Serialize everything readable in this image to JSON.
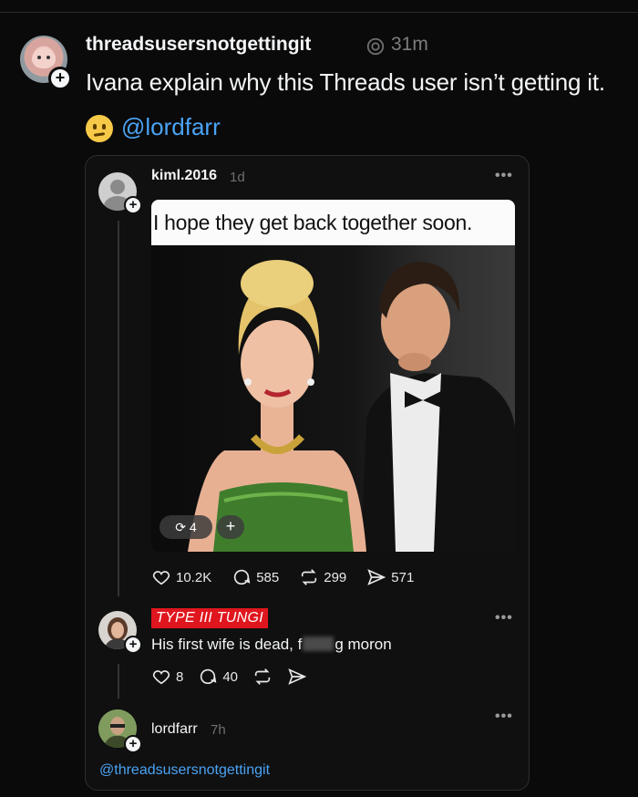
{
  "post": {
    "username": "threadsusersnotgettingit",
    "time": "31m",
    "text": "Ivana explain why this Threads user isn’t getting it.",
    "mention": "@lordfarr",
    "emoji_icon": "slightly-smiling-face-icon"
  },
  "quoted": {
    "username": "kiml.2016",
    "time": "1d",
    "meme_caption": "I hope they get back together soon.",
    "repost_chip": "4",
    "plus_chip": "+",
    "stats": {
      "likes": "10.2K",
      "replies": "585",
      "reposts": "299",
      "shares": "571"
    }
  },
  "reply": {
    "tag": "TYPE III TUNGI",
    "text_before": "His first wife is dead, f",
    "text_after": "g moron",
    "stats": {
      "likes": "8",
      "replies": "40"
    }
  },
  "reply2": {
    "username": "lordfarr",
    "time": "7h",
    "text": "@threadsusersnotgettingit"
  },
  "more_label": "•••",
  "colors": {
    "background": "#0a0a0a",
    "link": "#4aa3f5",
    "tag": "#e0161e"
  }
}
